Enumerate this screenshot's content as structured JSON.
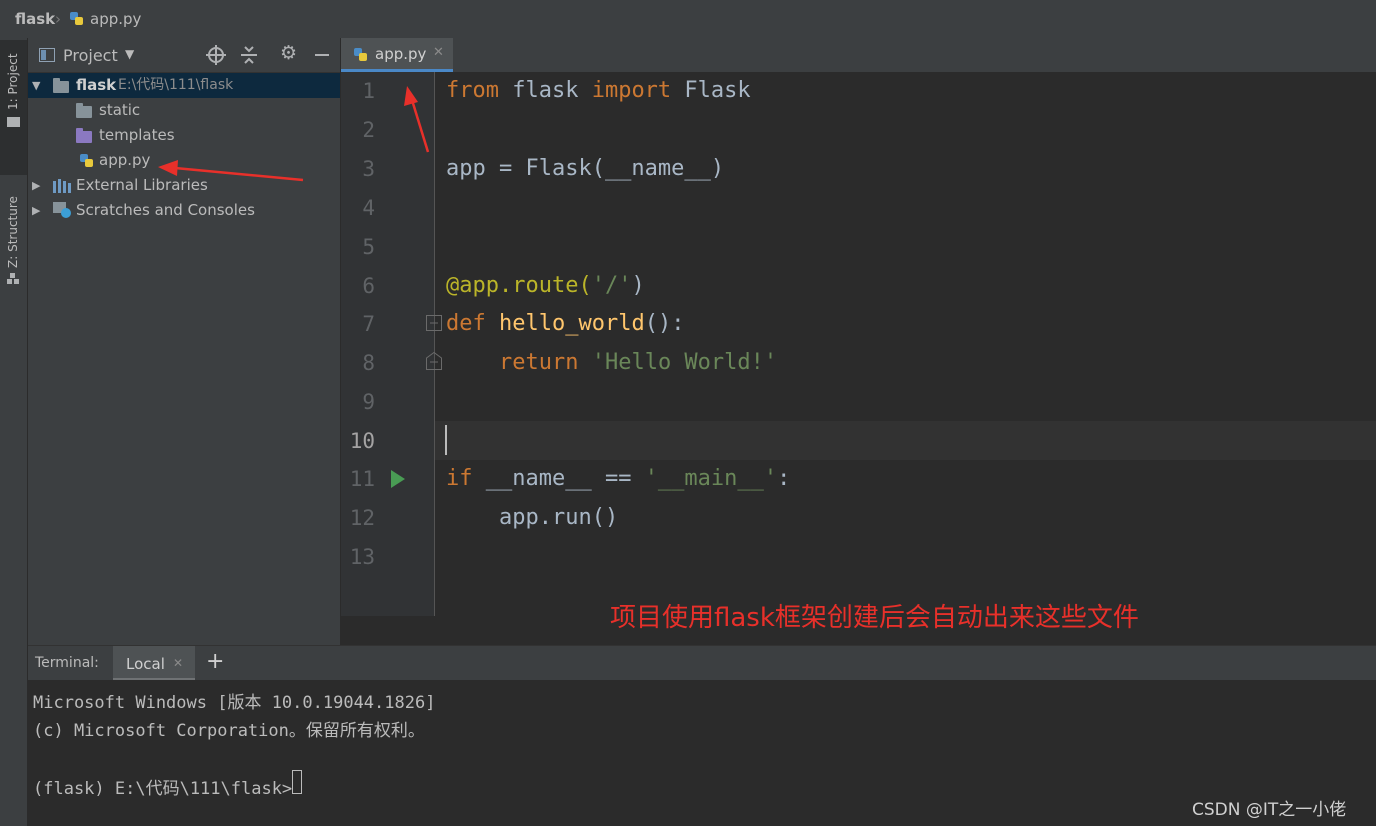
{
  "navbar": {
    "project": "flask",
    "file": "app.py"
  },
  "left_stripe": {
    "project_tab": "1: Project",
    "structure_tab": "Z: Structure"
  },
  "project_panel": {
    "title": "Project",
    "tree": [
      {
        "label": "flask",
        "path": "E:\\代码\\111\\flask"
      },
      {
        "label": "static"
      },
      {
        "label": "templates"
      },
      {
        "label": "app.py"
      },
      {
        "label": "External Libraries"
      },
      {
        "label": "Scratches and Consoles"
      }
    ]
  },
  "editor": {
    "tab": "app.py",
    "line_numbers": [
      "1",
      "2",
      "3",
      "4",
      "5",
      "6",
      "7",
      "8",
      "9",
      "10",
      "11",
      "12",
      "13"
    ],
    "code": {
      "l1_kw1": "from",
      "l1_mod": " flask ",
      "l1_kw2": "import",
      "l1_cls": " Flask",
      "l3": "app = Flask(__name__)",
      "l6_dec": "@app.route(",
      "l6_str": "'/'",
      "l6_end": ")",
      "l7_kw": "def",
      "l7_fn": "hello_world",
      "l7_end": "():",
      "l8_kw": "return",
      "l8_str": "'Hello World!'",
      "l11_kw": "if",
      "l11_mid": " __name__ == ",
      "l11_str": "'__main__'",
      "l11_end": ":",
      "l12": "app.run()"
    },
    "annotation": "项目使用flask框架创建后会自动出来这些文件"
  },
  "terminal": {
    "label": "Terminal:",
    "tab": "Local",
    "lines": [
      "Microsoft Windows [版本 10.0.19044.1826]",
      "(c) Microsoft Corporation。保留所有权利。",
      "",
      "(flask) E:\\代码\\111\\flask>"
    ]
  },
  "watermark": "CSDN @IT之一小佬",
  "colors": {
    "keyword": "#cc7832",
    "function": "#ffc66d",
    "string": "#6a8759",
    "decorator": "#bbb529",
    "annotation_red": "#e8302a"
  }
}
